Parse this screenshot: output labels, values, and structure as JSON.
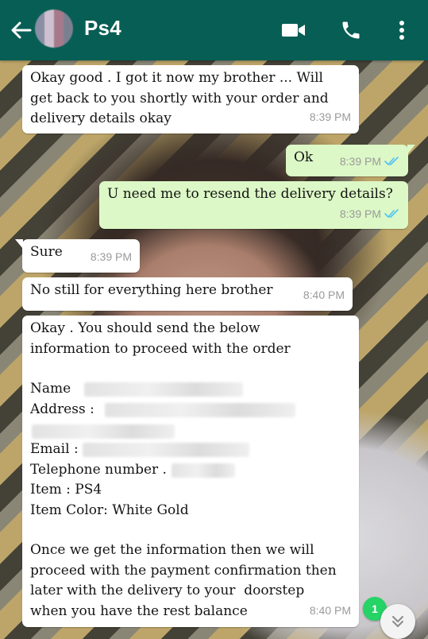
{
  "header": {
    "contact_name": "Ps4",
    "icons": [
      "back-arrow-icon",
      "video-call-icon",
      "phone-call-icon",
      "more-vert-icon"
    ]
  },
  "messages": [
    {
      "direction": "in",
      "lines": [
        "Okay good . I got it now my brother ... Will",
        "get back to you shortly with your order and",
        "delivery details okay"
      ],
      "time": "8:39 PM"
    },
    {
      "direction": "out",
      "text": "Ok",
      "time": "8:39 PM",
      "status": "read"
    },
    {
      "direction": "out",
      "text": "U need me to resend the delivery details?",
      "time": "8:39 PM",
      "status": "read"
    },
    {
      "direction": "in",
      "text": "Sure",
      "time": "8:39 PM"
    },
    {
      "direction": "in",
      "text": "No still for everything here brother",
      "time": "8:40 PM"
    },
    {
      "direction": "in",
      "intro": [
        "Okay . You should send the below",
        "information to proceed with the order"
      ],
      "fields": {
        "name_label": "Name",
        "address_label": "Address :",
        "email_label": "Email :",
        "telephone_label": "Telephone number .",
        "item_line": "Item : PS4",
        "item_color_line": "Item Color: White Gold"
      },
      "outro": [
        "Once we get the information then we will",
        "proceed with the payment confirmation then",
        "later with the delivery to your  doorstep",
        "when you have the rest balance"
      ],
      "time": "8:40 PM"
    }
  ],
  "unread_count": "1",
  "colors": {
    "header": "#075e54",
    "outgoing_bubble": "#dcf8c6",
    "incoming_bubble": "#ffffff",
    "read_ticks": "#4fc3f7",
    "badge": "#25d366"
  }
}
